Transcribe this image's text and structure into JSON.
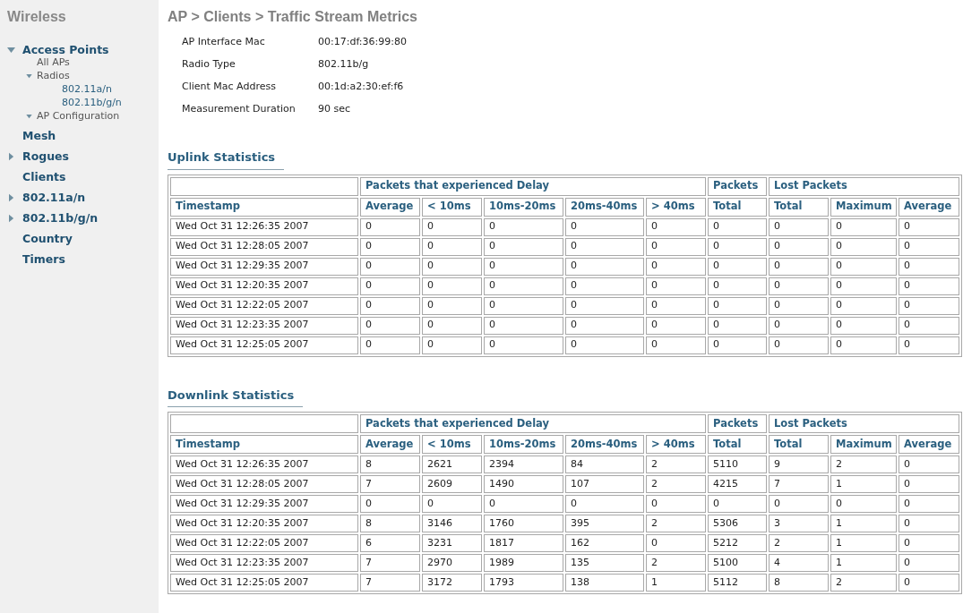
{
  "sidebar": {
    "title": "Wireless",
    "items": [
      {
        "label": "Access Points",
        "kind": "folder",
        "expanded": true,
        "children": [
          {
            "label": "All APs",
            "kind": "leaf"
          },
          {
            "label": "Radios",
            "kind": "folder",
            "expanded": true,
            "children": [
              {
                "label": "802.11a/n",
                "kind": "leaf"
              },
              {
                "label": "802.11b/g/n",
                "kind": "leaf"
              }
            ]
          },
          {
            "label": "AP Configuration",
            "kind": "folder",
            "expanded": true
          }
        ]
      },
      {
        "label": "Mesh",
        "kind": "leaf"
      },
      {
        "label": "Rogues",
        "kind": "folder",
        "expanded": false
      },
      {
        "label": "Clients",
        "kind": "leaf"
      },
      {
        "label": "802.11a/n",
        "kind": "folder",
        "expanded": false
      },
      {
        "label": "802.11b/g/n",
        "kind": "folder",
        "expanded": false
      },
      {
        "label": "Country",
        "kind": "leaf"
      },
      {
        "label": "Timers",
        "kind": "leaf"
      }
    ]
  },
  "page_title": "AP > Clients > Traffic Stream Metrics",
  "details": [
    {
      "label": "AP Interface Mac",
      "value": "00:17:df:36:99:80"
    },
    {
      "label": "Radio Type",
      "value": "802.11b/g"
    },
    {
      "label": "Client Mac Address",
      "value": "00:1d:a2:30:ef:f6"
    },
    {
      "label": "Measurement Duration",
      "value": "90 sec"
    }
  ],
  "tables": [
    {
      "title": "Uplink Statistics",
      "groups": [
        "Packets that experienced Delay",
        "Packets",
        "Lost Packets"
      ],
      "columns": [
        "Timestamp",
        "Average",
        "< 10ms",
        "10ms-20ms",
        "20ms-40ms",
        "> 40ms",
        "Total",
        "Total",
        "Maximum",
        "Average"
      ],
      "rows": [
        [
          "Wed Oct 31 12:26:35 2007",
          "0",
          "0",
          "0",
          "0",
          "0",
          "0",
          "0",
          "0",
          "0"
        ],
        [
          "Wed Oct 31 12:28:05 2007",
          "0",
          "0",
          "0",
          "0",
          "0",
          "0",
          "0",
          "0",
          "0"
        ],
        [
          "Wed Oct 31 12:29:35 2007",
          "0",
          "0",
          "0",
          "0",
          "0",
          "0",
          "0",
          "0",
          "0"
        ],
        [
          "Wed Oct 31 12:20:35 2007",
          "0",
          "0",
          "0",
          "0",
          "0",
          "0",
          "0",
          "0",
          "0"
        ],
        [
          "Wed Oct 31 12:22:05 2007",
          "0",
          "0",
          "0",
          "0",
          "0",
          "0",
          "0",
          "0",
          "0"
        ],
        [
          "Wed Oct 31 12:23:35 2007",
          "0",
          "0",
          "0",
          "0",
          "0",
          "0",
          "0",
          "0",
          "0"
        ],
        [
          "Wed Oct 31 12:25:05 2007",
          "0",
          "0",
          "0",
          "0",
          "0",
          "0",
          "0",
          "0",
          "0"
        ]
      ]
    },
    {
      "title": "Downlink Statistics",
      "groups": [
        "Packets that experienced Delay",
        "Packets",
        "Lost Packets"
      ],
      "columns": [
        "Timestamp",
        "Average",
        "< 10ms",
        "10ms-20ms",
        "20ms-40ms",
        "> 40ms",
        "Total",
        "Total",
        "Maximum",
        "Average"
      ],
      "rows": [
        [
          "Wed Oct 31 12:26:35 2007",
          "8",
          "2621",
          "2394",
          "84",
          "2",
          "5110",
          "9",
          "2",
          "0"
        ],
        [
          "Wed Oct 31 12:28:05 2007",
          "7",
          "2609",
          "1490",
          "107",
          "2",
          "4215",
          "7",
          "1",
          "0"
        ],
        [
          "Wed Oct 31 12:29:35 2007",
          "0",
          "0",
          "0",
          "0",
          "0",
          "0",
          "0",
          "0",
          "0"
        ],
        [
          "Wed Oct 31 12:20:35 2007",
          "8",
          "3146",
          "1760",
          "395",
          "2",
          "5306",
          "3",
          "1",
          "0"
        ],
        [
          "Wed Oct 31 12:22:05 2007",
          "6",
          "3231",
          "1817",
          "162",
          "0",
          "5212",
          "2",
          "1",
          "0"
        ],
        [
          "Wed Oct 31 12:23:35 2007",
          "7",
          "2970",
          "1989",
          "135",
          "2",
          "5100",
          "4",
          "1",
          "0"
        ],
        [
          "Wed Oct 31 12:25:05 2007",
          "7",
          "3172",
          "1793",
          "138",
          "1",
          "5112",
          "8",
          "2",
          "0"
        ]
      ]
    }
  ]
}
